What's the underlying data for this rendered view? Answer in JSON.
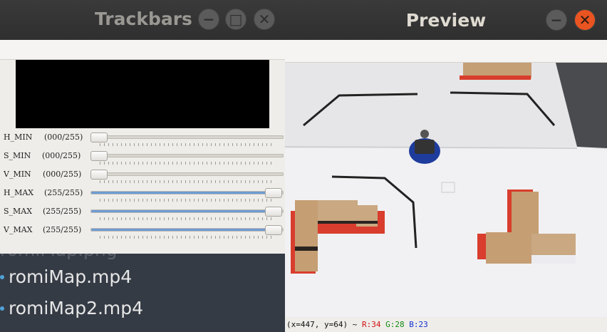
{
  "background": {
    "files": [
      {
        "name": "romiMap.png"
      },
      {
        "name": "romiMap.mp4"
      },
      {
        "name": "romiMap2.mp4"
      }
    ]
  },
  "trackbars_window": {
    "title": "Trackbars",
    "controls": [
      {
        "name": "H_MIN",
        "value_text": "(000/255)",
        "value": 0,
        "max": 255
      },
      {
        "name": "S_MIN",
        "value_text": "(000/255)",
        "value": 0,
        "max": 255
      },
      {
        "name": "V_MIN",
        "value_text": "(000/255)",
        "value": 0,
        "max": 255
      },
      {
        "name": "H_MAX",
        "value_text": "(255/255)",
        "value": 255,
        "max": 255
      },
      {
        "name": "S_MAX",
        "value_text": "(255/255)",
        "value": 255,
        "max": 255
      },
      {
        "name": "V_MAX",
        "value_text": "(255/255)",
        "value": 255,
        "max": 255
      }
    ],
    "buttons": {
      "minimize": "−",
      "maximize": "□",
      "close": "✕"
    }
  },
  "preview_window": {
    "title": "Preview",
    "buttons": {
      "minimize": "−",
      "close": "✕"
    },
    "status": {
      "coords": "(x=447, y=64) ~",
      "r": "R:34",
      "g": "G:28",
      "b": "B:23"
    },
    "colors": {
      "r": "#d01010",
      "g": "#108a10",
      "b": "#1030d0"
    }
  }
}
